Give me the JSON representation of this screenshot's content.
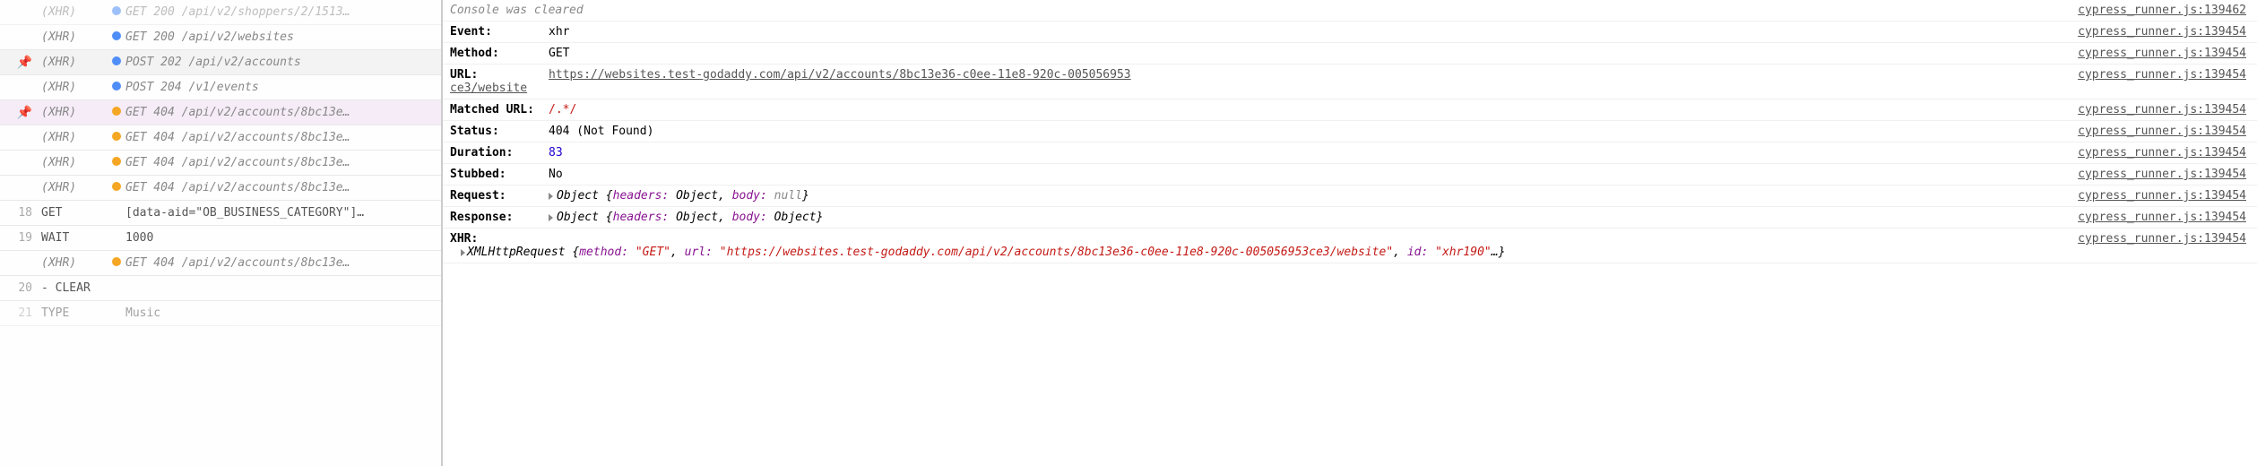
{
  "left": {
    "rows": [
      {
        "type": "xhr",
        "faded": true,
        "dot": "blue",
        "msg": "GET 200 /api/v2/shoppers/2/1513…"
      },
      {
        "type": "xhr",
        "dot": "blue",
        "msg": "GET 200 /api/v2/websites"
      },
      {
        "type": "xhr",
        "pin": "gray",
        "dot": "blue",
        "msg": "POST 202 /api/v2/accounts"
      },
      {
        "type": "xhr",
        "dot": "blue",
        "msg": "POST 204 /v1/events"
      },
      {
        "type": "xhr",
        "pin": "purple",
        "dot": "orange",
        "msg": "GET 404 /api/v2/accounts/8bc13e…"
      },
      {
        "type": "xhr",
        "dot": "orange",
        "msg": "GET 404 /api/v2/accounts/8bc13e…"
      },
      {
        "type": "xhr",
        "dot": "orange",
        "msg": "GET 404 /api/v2/accounts/8bc13e…"
      },
      {
        "type": "xhr",
        "dot": "orange",
        "msg": "GET 404 /api/v2/accounts/8bc13e…"
      },
      {
        "type": "cmd",
        "num": "18",
        "tag": "GET",
        "msg": "[data-aid=\"OB_BUSINESS_CATEGORY\"]…"
      },
      {
        "type": "cmd",
        "num": "19",
        "tag": "WAIT",
        "msg": "1000"
      },
      {
        "type": "xhr",
        "dot": "orange",
        "msg": "GET 404 /api/v2/accounts/8bc13e…"
      },
      {
        "type": "cmd",
        "num": "20",
        "tag": "- CLEAR",
        "msg": ""
      },
      {
        "type": "cmd",
        "num": "21",
        "tag": "  TYPE",
        "msg": "Music",
        "faded": true
      }
    ]
  },
  "right": {
    "clearedMsg": "Console was cleared",
    "srcBase": "cypress_runner.js:",
    "lines": [
      {
        "label": "",
        "cleared": true,
        "src": "139462"
      },
      {
        "label": "Event:",
        "val": "xhr",
        "src": "139454"
      },
      {
        "label": "Method:",
        "val": "GET",
        "src": "139454"
      },
      {
        "label": "URL:",
        "kind": "url",
        "url": "https://websites.test-godaddy.com/api/v2/accounts/8bc13e36-c0ee-11e8-920c-005056953ce3/website",
        "urlShown": "https://websites.test-godaddy.com/api/v2/accounts/8bc13e36-c0ee-11e8-920c-005056953",
        "urlTrail": "ce3/website",
        "src": "139454"
      },
      {
        "label": "Matched URL:",
        "kind": "red",
        "val": "/.*/",
        "src": "139454"
      },
      {
        "label": "Status:",
        "val": "404 (Not Found)",
        "src": "139454"
      },
      {
        "label": "Duration:",
        "kind": "blue",
        "val": "83",
        "src": "139454"
      },
      {
        "label": "Stubbed:",
        "val": "No",
        "src": "139454"
      },
      {
        "label": "Request:",
        "kind": "obj",
        "objBody": "null",
        "src": "139454"
      },
      {
        "label": "Response:",
        "kind": "obj",
        "objBody": "Object",
        "src": "139454"
      },
      {
        "label": "XHR:",
        "kind": "xhr",
        "src": "139454",
        "xhrMethod": "\"GET\"",
        "xhrUrl": "\"https://websites.test-godaddy.com/api/v2/accounts/8bc13e36-c0ee-11e8-920c-005056953ce3/website\"",
        "xhrId": "\"xhr190\""
      }
    ],
    "tokens": {
      "object": "Object",
      "headers": "headers:",
      "body": "body:",
      "xhrCtor": "XMLHttpRequest",
      "method": "method:",
      "url": "url:",
      "id": "id:",
      "ellipsis": "…"
    }
  }
}
